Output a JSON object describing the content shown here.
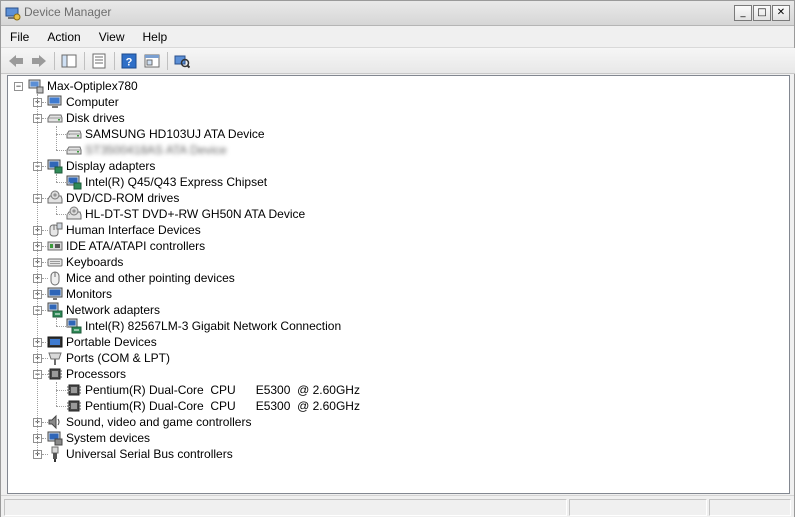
{
  "window": {
    "title": "Device Manager",
    "minimize": "_",
    "maximize": "□",
    "close": "✕"
  },
  "menu": [
    {
      "id": "file",
      "label": "File"
    },
    {
      "id": "action",
      "label": "Action"
    },
    {
      "id": "view",
      "label": "View"
    },
    {
      "id": "help",
      "label": "Help"
    }
  ],
  "toolbar": {
    "buttons": [
      "back-icon",
      "forward-icon",
      "show-hide-console-tree-icon",
      "properties-icon",
      "help-icon",
      "update-driver-icon",
      "scan-hardware-icon"
    ]
  },
  "tree": {
    "root": "Max-Optiplex780",
    "categories": [
      {
        "label": "Computer",
        "icon": "computer-icon",
        "expanded": false,
        "children": []
      },
      {
        "label": "Disk drives",
        "icon": "disk-drive-icon",
        "expanded": true,
        "children": [
          {
            "label": "SAMSUNG HD103UJ ATA Device",
            "icon": "disk-drive-icon"
          },
          {
            "label": "ST3500418AS ATA Device",
            "icon": "disk-drive-icon",
            "blurred": true
          }
        ]
      },
      {
        "label": "Display adapters",
        "icon": "display-adapter-icon",
        "expanded": true,
        "children": [
          {
            "label": "Intel(R) Q45/Q43 Express Chipset",
            "icon": "display-adapter-icon"
          }
        ]
      },
      {
        "label": "DVD/CD-ROM drives",
        "icon": "dvd-drive-icon",
        "expanded": true,
        "children": [
          {
            "label": "HL-DT-ST DVD+-RW GH50N ATA Device",
            "icon": "dvd-drive-icon"
          }
        ]
      },
      {
        "label": "Human Interface Devices",
        "icon": "hid-icon",
        "expanded": false,
        "children": []
      },
      {
        "label": "IDE ATA/ATAPI controllers",
        "icon": "ide-controller-icon",
        "expanded": false,
        "children": []
      },
      {
        "label": "Keyboards",
        "icon": "keyboard-icon",
        "expanded": false,
        "children": []
      },
      {
        "label": "Mice and other pointing devices",
        "icon": "mouse-icon",
        "expanded": false,
        "children": []
      },
      {
        "label": "Monitors",
        "icon": "monitor-icon",
        "expanded": false,
        "children": []
      },
      {
        "label": "Network adapters",
        "icon": "network-adapter-icon",
        "expanded": true,
        "children": [
          {
            "label": "Intel(R) 82567LM-3 Gigabit Network Connection",
            "icon": "network-adapter-icon"
          }
        ]
      },
      {
        "label": "Portable Devices",
        "icon": "portable-device-icon",
        "expanded": false,
        "children": []
      },
      {
        "label": "Ports (COM & LPT)",
        "icon": "port-icon",
        "expanded": false,
        "children": []
      },
      {
        "label": "Processors",
        "icon": "processor-icon",
        "expanded": true,
        "children": [
          {
            "label": "Pentium(R) Dual-Core  CPU      E5300  @ 2.60GHz",
            "icon": "processor-icon"
          },
          {
            "label": "Pentium(R) Dual-Core  CPU      E5300  @ 2.60GHz",
            "icon": "processor-icon"
          }
        ]
      },
      {
        "label": "Sound, video and game controllers",
        "icon": "sound-icon",
        "expanded": false,
        "children": []
      },
      {
        "label": "System devices",
        "icon": "system-device-icon",
        "expanded": false,
        "children": []
      },
      {
        "label": "Universal Serial Bus controllers",
        "icon": "usb-icon",
        "expanded": false,
        "children": []
      }
    ]
  },
  "colors": {
    "tree_bg": "#ffffff",
    "chrome_bg": "#f0f0f0",
    "title_text": "#6d6d6d"
  }
}
